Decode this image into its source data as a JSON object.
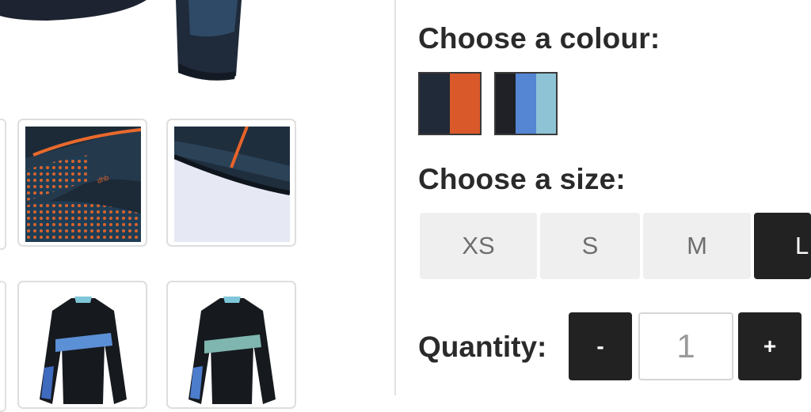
{
  "colour": {
    "heading": "Choose a colour:",
    "options": [
      {
        "name": "navy-orange",
        "colors": [
          "#212a38",
          "#d9592a"
        ]
      },
      {
        "name": "black-blue",
        "colors": [
          "#1f2126",
          "#5586d4",
          "#8ec3d6"
        ]
      }
    ]
  },
  "size": {
    "heading": "Choose a size:",
    "options": [
      "XS",
      "S",
      "M",
      "L"
    ],
    "selected": "L"
  },
  "quantity": {
    "label": "Quantity:",
    "decrement_label": "-",
    "increment_label": "+",
    "value": "1"
  },
  "gallery": {
    "main_image": "jacket-sleeve-photo",
    "thumbnails": [
      "fabric-detail-photo",
      "hem-detail-photo",
      "jacket-front-photo",
      "jacket-front-alt-photo"
    ]
  }
}
